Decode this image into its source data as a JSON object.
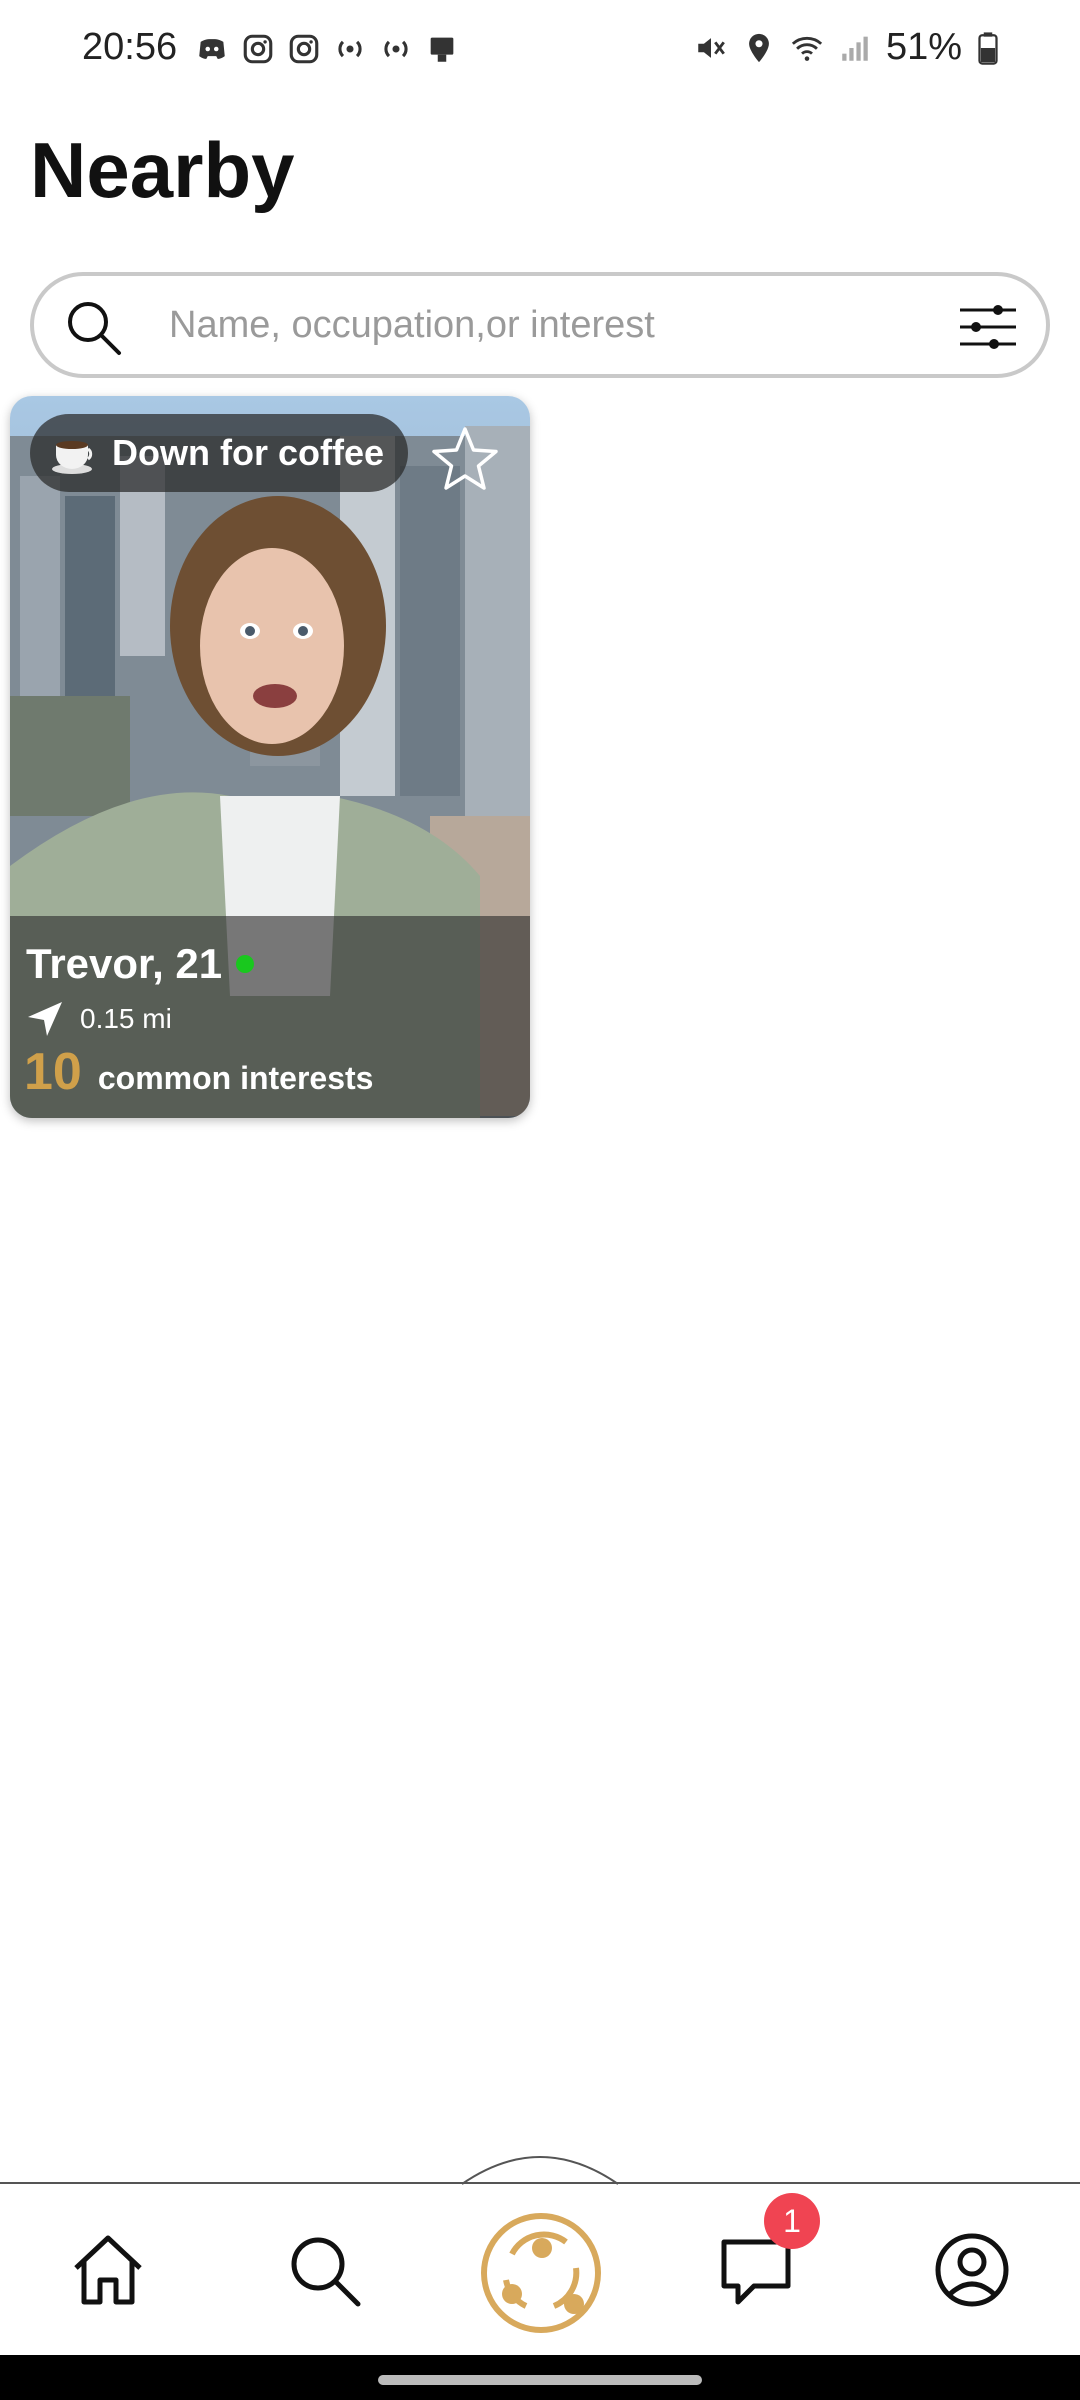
{
  "status_bar": {
    "time": "20:56",
    "battery_percent": "51%",
    "left_icons": [
      "discord-icon",
      "instagram-icon",
      "instagram-icon",
      "broadcast-icon",
      "broadcast-icon",
      "device-icon"
    ],
    "right_icons": [
      "mute-icon",
      "location-icon",
      "wifi-icon",
      "signal-icon",
      "battery-icon"
    ]
  },
  "header": {
    "title": "Nearby"
  },
  "search": {
    "placeholder": "Name, occupation,or interest",
    "value": ""
  },
  "cards": [
    {
      "status_label": "Down for coffee",
      "status_icon": "coffee-cup-icon",
      "name_age": "Trevor, 21",
      "online": true,
      "distance": "0.15 mi",
      "common_count": "10",
      "common_label": "common interests",
      "favorited": false
    }
  ],
  "bottom_nav": {
    "items": [
      "home-icon",
      "search-icon",
      "connect-icon",
      "messages-icon",
      "profile-icon"
    ],
    "messages_badge": "1"
  },
  "colors": {
    "accent_gold": "#d0a04a",
    "online_green": "#19c81e",
    "badge_red": "#f04452"
  }
}
